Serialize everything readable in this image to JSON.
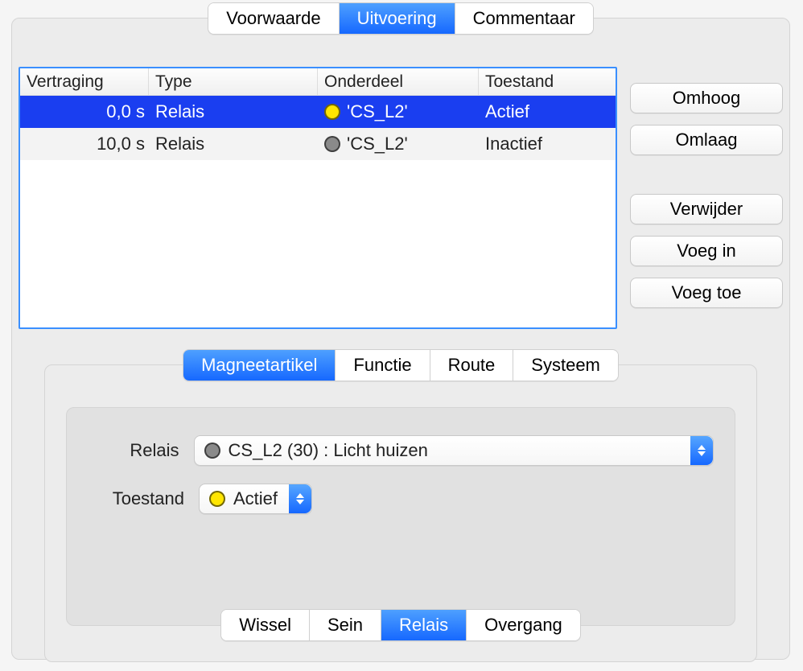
{
  "topTabs": {
    "items": [
      {
        "label": "Voorwaarde",
        "active": false
      },
      {
        "label": "Uitvoering",
        "active": true
      },
      {
        "label": "Commentaar",
        "active": false
      }
    ]
  },
  "table": {
    "headers": {
      "delay": "Vertraging",
      "type": "Type",
      "part": "Onderdeel",
      "state": "Toestand"
    },
    "rows": [
      {
        "delay": "0,0 s",
        "type": "Relais",
        "dot": "yellow",
        "part": "'CS_L2'",
        "state": "Actief",
        "selected": true
      },
      {
        "delay": "10,0 s",
        "type": "Relais",
        "dot": "gray",
        "part": "'CS_L2'",
        "state": "Inactief",
        "selected": false
      }
    ]
  },
  "sideButtons": {
    "up": "Omhoog",
    "down": "Omlaag",
    "remove": "Verwijder",
    "insert": "Voeg in",
    "add": "Voeg toe"
  },
  "editorTabs": {
    "items": [
      {
        "label": "Magneetartikel",
        "active": true
      },
      {
        "label": "Functie",
        "active": false
      },
      {
        "label": "Route",
        "active": false
      },
      {
        "label": "Systeem",
        "active": false
      }
    ]
  },
  "form": {
    "relaisLabel": "Relais",
    "relaisValue": "CS_L2 (30) : Licht huizen",
    "relaisDot": "gray",
    "stateLabel": "Toestand",
    "stateValue": "Actief",
    "stateDot": "yellow"
  },
  "bottomTabs": {
    "items": [
      {
        "label": "Wissel",
        "active": false
      },
      {
        "label": "Sein",
        "active": false
      },
      {
        "label": "Relais",
        "active": true
      },
      {
        "label": "Overgang",
        "active": false
      }
    ]
  }
}
